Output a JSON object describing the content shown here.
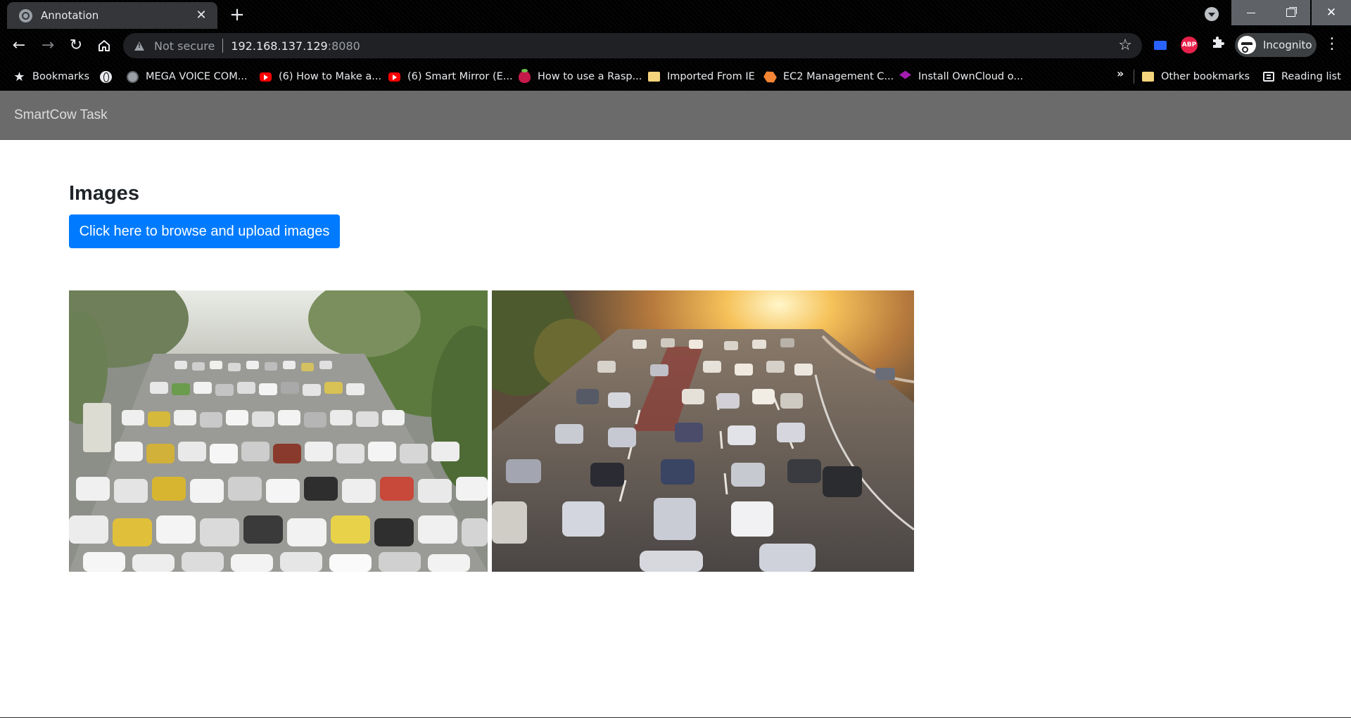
{
  "browser": {
    "tab_title": "Annotation",
    "tab_close": "✕",
    "new_tab": "+",
    "security_text": "Not secure",
    "url_host": "192.168.137.129",
    "url_port": ":8080",
    "profile_label": "Incognito",
    "ext_abp_label": "ABP"
  },
  "bookmarks": {
    "items": [
      {
        "label": "Bookmarks",
        "icon": "star-icon"
      },
      {
        "label": "",
        "icon": "globe-icon"
      },
      {
        "label": "MEGA VOICE COM...",
        "icon": "site-icon"
      },
      {
        "label": "(6) How to Make a...",
        "icon": "youtube-icon"
      },
      {
        "label": "(6) Smart Mirror (E...",
        "icon": "youtube-icon"
      },
      {
        "label": "How to use a Rasp...",
        "icon": "raspberry-icon"
      },
      {
        "label": "Imported From IE",
        "icon": "folder-icon"
      },
      {
        "label": "EC2 Management C...",
        "icon": "aws-icon"
      },
      {
        "label": "Install OwnCloud o...",
        "icon": "stack-icon"
      }
    ],
    "overflow": "»",
    "other_bookmarks": "Other bookmarks",
    "reading_list": "Reading list"
  },
  "page": {
    "brand": "SmartCow Task",
    "title": "Images",
    "upload_button": "Click here to browse and upload images"
  },
  "images": [
    {
      "name": "traffic-jam-image-1",
      "scene": "dense city traffic jam with trees"
    },
    {
      "name": "traffic-jam-image-2",
      "scene": "highway traffic at sunset"
    }
  ]
}
